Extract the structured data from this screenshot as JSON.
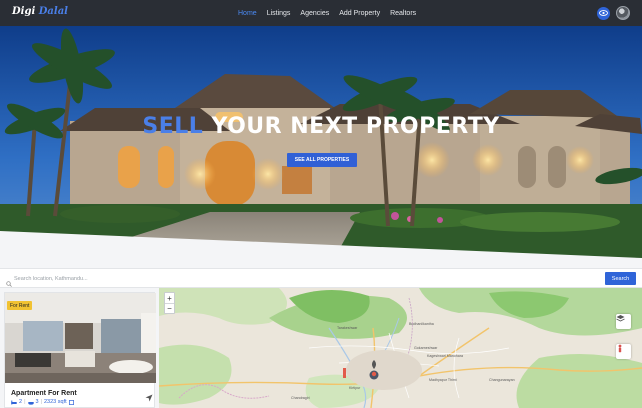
{
  "navbar": {
    "logo": {
      "part1": "Digi",
      "part2": "Dalal"
    },
    "links": [
      "Home",
      "Listings",
      "Agencies",
      "Add Property",
      "Realtors"
    ],
    "active_index": 0
  },
  "hero": {
    "title_highlight": "SELL",
    "title_rest": "YOUR NEXT PROPERTY",
    "button_label": "SEE ALL PROPERTIES"
  },
  "search": {
    "placeholder": "Search location, Kathmandu...",
    "button_label": "Search"
  },
  "listing": {
    "badge": "For Rent",
    "title": "Apartment For Rent",
    "bedrooms": "2",
    "bathrooms": "3",
    "area": "2323 sqft"
  },
  "map": {
    "zoom_in": "+",
    "zoom_out": "−",
    "labels": [
      "Tarakeshwar",
      "Budhanilkantha",
      "Gokarneshwar",
      "Kageshwari Manohara",
      "Changunarayan",
      "Chandragiri",
      "Madhyapur Thimi",
      "Kirtipur"
    ]
  }
}
